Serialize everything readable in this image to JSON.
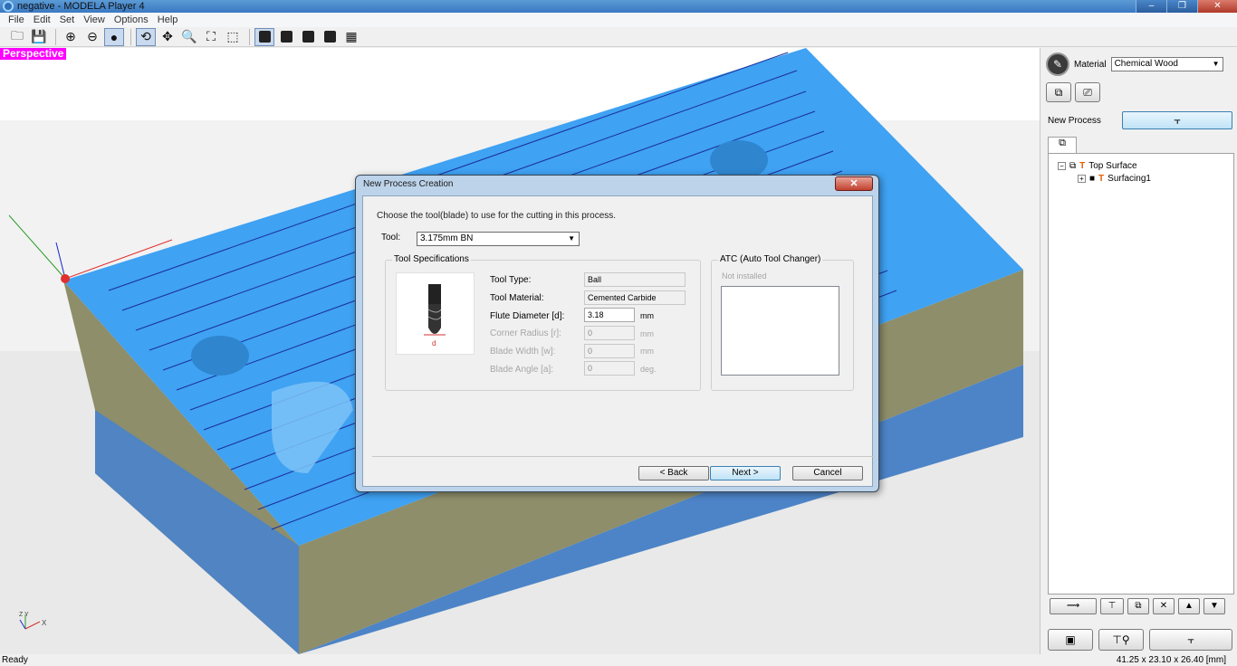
{
  "window": {
    "title": "negative - MODELA Player 4",
    "min": "–",
    "max": "❐",
    "close": "✕"
  },
  "menu": [
    "File",
    "Edit",
    "Set",
    "View",
    "Options",
    "Help"
  ],
  "viewport": {
    "label": "Perspective",
    "colors": {
      "blue": "#3fa2f3",
      "side": "#8e8e6a",
      "bottom": "#4d84c7"
    }
  },
  "right_panel": {
    "material_label": "Material",
    "material_value": "Chemical Wood",
    "new_process_label": "New Process",
    "tree": {
      "root": "Top Surface",
      "child": "Surfacing1"
    }
  },
  "status": {
    "left": "Ready",
    "right": "41.25 x 23.10 x 26.40 [mm]"
  },
  "dialog": {
    "title": "New Process Creation",
    "close": "✕",
    "instruction": "Choose the tool(blade) to use for the cutting in this process.",
    "tool_label": "Tool:",
    "tool_value": "3.175mm BN",
    "spec_group": "Tool Specifications",
    "specs": {
      "type_label": "Tool Type:",
      "type_value": "Ball",
      "material_label": "Tool Material:",
      "material_value": "Cemented Carbide",
      "flute_label": "Flute Diameter [d]:",
      "flute_value": "3.18",
      "flute_unit": "mm",
      "corner_label": "Corner Radius [r]:",
      "corner_value": "0",
      "corner_unit": "mm",
      "width_label": "Blade Width [w]:",
      "width_value": "0",
      "width_unit": "mm",
      "angle_label": "Blade Angle [a]:",
      "angle_value": "0",
      "angle_unit": "deg."
    },
    "diagram_label": "d",
    "atc_group": "ATC (Auto Tool Changer)",
    "atc_status": "Not installed",
    "back": "< Back",
    "next": "Next >",
    "cancel": "Cancel"
  },
  "axis_mini": {
    "z": "Z",
    "y": "Y",
    "x": "X"
  }
}
